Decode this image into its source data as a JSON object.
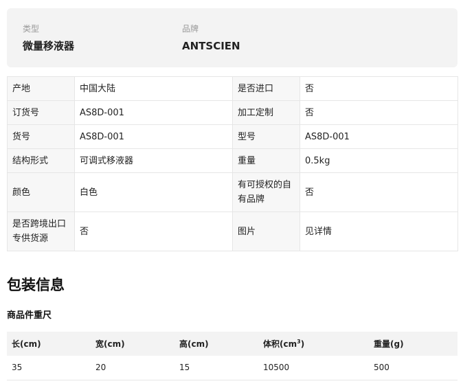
{
  "summary": {
    "type_label": "类型",
    "type_value": "微量移液器",
    "brand_label": "品牌",
    "brand_value": "ANTSCIEN"
  },
  "attributes": [
    [
      {
        "k": "产地",
        "v": "中国大陆"
      },
      {
        "k": "是否进口",
        "v": "否"
      }
    ],
    [
      {
        "k": "订货号",
        "v": "AS8D-001"
      },
      {
        "k": "加工定制",
        "v": "否"
      }
    ],
    [
      {
        "k": "货号",
        "v": "AS8D-001"
      },
      {
        "k": "型号",
        "v": "AS8D-001"
      }
    ],
    [
      {
        "k": "结构形式",
        "v": "可调式移液器"
      },
      {
        "k": "重量",
        "v": "0.5kg"
      }
    ],
    [
      {
        "k": "颜色",
        "v": "白色"
      },
      {
        "k": "有可授权的自有品牌",
        "v": "否"
      }
    ],
    [
      {
        "k": "是否跨境出口专供货源",
        "v": "否"
      },
      {
        "k": "图片",
        "v": "见详情"
      }
    ]
  ],
  "packaging": {
    "title": "包装信息",
    "subtitle": "商品件重尺",
    "headers": [
      "长(cm)",
      "宽(cm)",
      "高(cm)",
      "体积(cm",
      "重量(g)"
    ],
    "volume_sup": "3",
    "volume_close": ")",
    "row": [
      "35",
      "20",
      "15",
      "10500",
      "500"
    ]
  }
}
